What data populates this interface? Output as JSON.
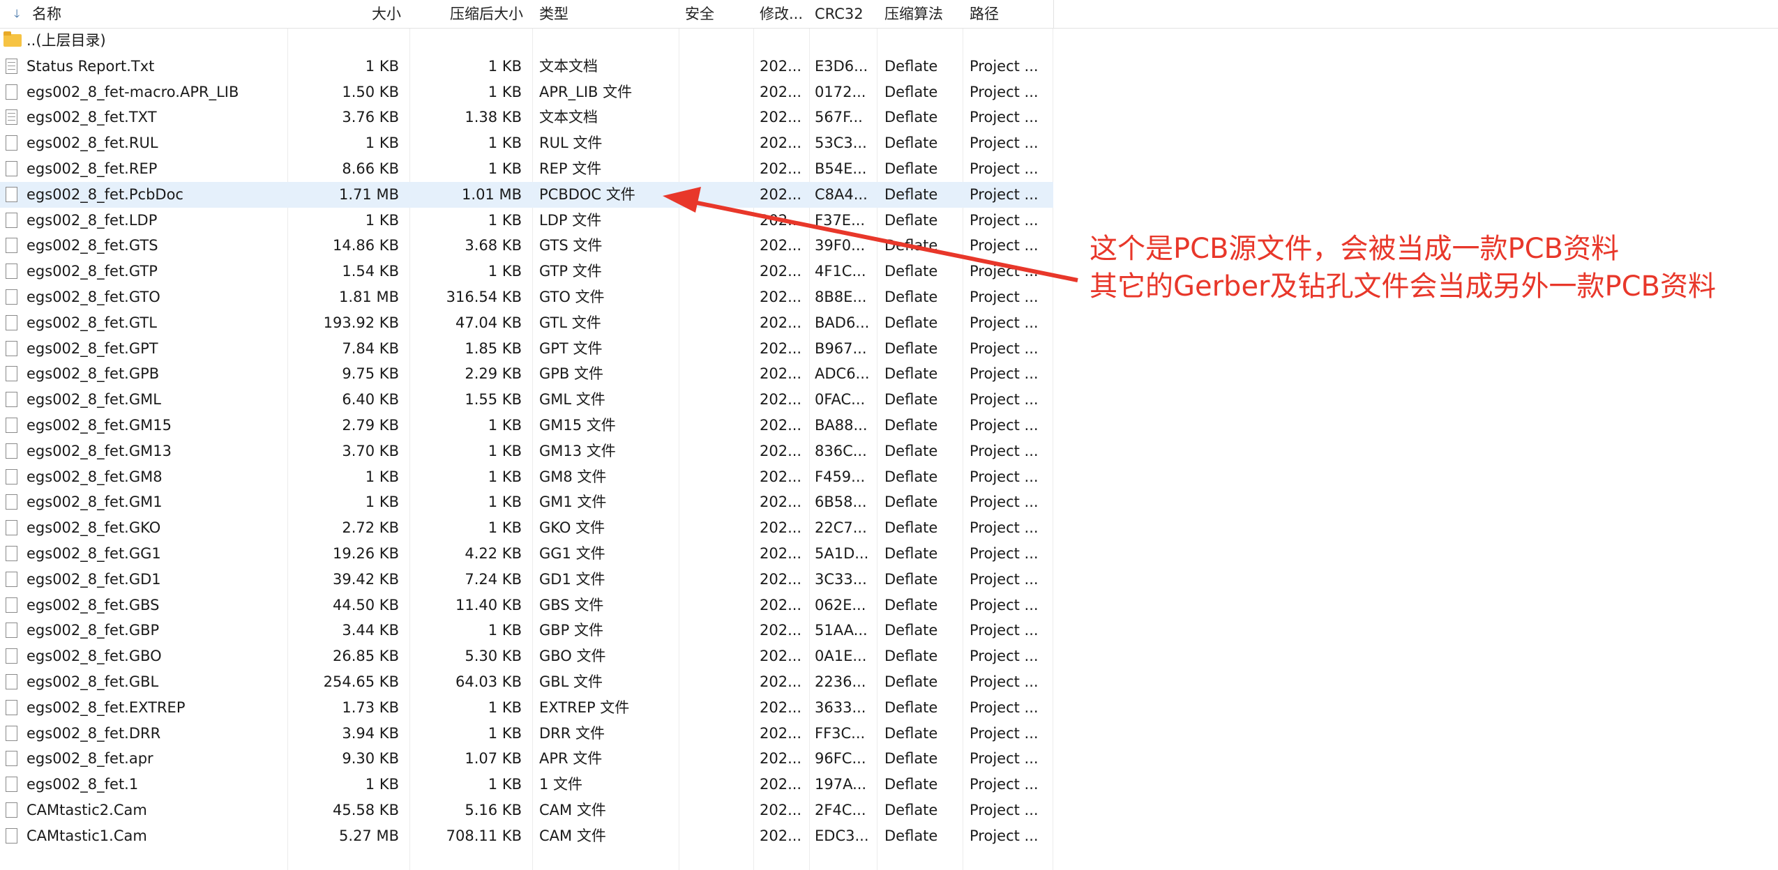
{
  "columns": {
    "name": "名称",
    "size": "大小",
    "compressed": "压缩后大小",
    "type": "类型",
    "security": "安全",
    "modified": "修改...",
    "crc": "CRC32",
    "algorithm": "压缩算法",
    "path": "路径"
  },
  "parent_row": {
    "name": "..(上层目录)"
  },
  "files": [
    {
      "name": "Status Report.Txt",
      "size": "1 KB",
      "compressed": "1 KB",
      "type": "文本文档",
      "modified": "202...",
      "crc": "E3D6...",
      "algorithm": "Deflate",
      "path": "Project ...",
      "icon": "text-file-icon"
    },
    {
      "name": "egs002_8_fet-macro.APR_LIB",
      "size": "1.50 KB",
      "compressed": "1 KB",
      "type": "APR_LIB 文件",
      "modified": "202...",
      "crc": "0172...",
      "algorithm": "Deflate",
      "path": "Project ...",
      "icon": "file-icon"
    },
    {
      "name": "egs002_8_fet.TXT",
      "size": "3.76 KB",
      "compressed": "1.38 KB",
      "type": "文本文档",
      "modified": "202...",
      "crc": "567F...",
      "algorithm": "Deflate",
      "path": "Project ...",
      "icon": "text-file-icon"
    },
    {
      "name": "egs002_8_fet.RUL",
      "size": "1 KB",
      "compressed": "1 KB",
      "type": "RUL 文件",
      "modified": "202...",
      "crc": "53C3...",
      "algorithm": "Deflate",
      "path": "Project ...",
      "icon": "file-icon"
    },
    {
      "name": "egs002_8_fet.REP",
      "size": "8.66 KB",
      "compressed": "1 KB",
      "type": "REP 文件",
      "modified": "202...",
      "crc": "B54E...",
      "algorithm": "Deflate",
      "path": "Project ...",
      "icon": "file-icon"
    },
    {
      "name": "egs002_8_fet.PcbDoc",
      "size": "1.71 MB",
      "compressed": "1.01 MB",
      "type": "PCBDOC 文件",
      "modified": "202...",
      "crc": "C8A4...",
      "algorithm": "Deflate",
      "path": "Project ...",
      "icon": "file-icon",
      "selected": true
    },
    {
      "name": "egs002_8_fet.LDP",
      "size": "1 KB",
      "compressed": "1 KB",
      "type": "LDP 文件",
      "modified": "202...",
      "crc": "F37E...",
      "algorithm": "Deflate",
      "path": "Project ...",
      "icon": "file-icon"
    },
    {
      "name": "egs002_8_fet.GTS",
      "size": "14.86 KB",
      "compressed": "3.68 KB",
      "type": "GTS 文件",
      "modified": "202...",
      "crc": "39F0...",
      "algorithm": "Deflate",
      "path": "Project ...",
      "icon": "file-icon"
    },
    {
      "name": "egs002_8_fet.GTP",
      "size": "1.54 KB",
      "compressed": "1 KB",
      "type": "GTP 文件",
      "modified": "202...",
      "crc": "4F1C...",
      "algorithm": "Deflate",
      "path": "Project ...",
      "icon": "file-icon"
    },
    {
      "name": "egs002_8_fet.GTO",
      "size": "1.81 MB",
      "compressed": "316.54 KB",
      "type": "GTO 文件",
      "modified": "202...",
      "crc": "8B8E...",
      "algorithm": "Deflate",
      "path": "Project ...",
      "icon": "file-icon"
    },
    {
      "name": "egs002_8_fet.GTL",
      "size": "193.92 KB",
      "compressed": "47.04 KB",
      "type": "GTL 文件",
      "modified": "202...",
      "crc": "BAD6...",
      "algorithm": "Deflate",
      "path": "Project ...",
      "icon": "file-icon"
    },
    {
      "name": "egs002_8_fet.GPT",
      "size": "7.84 KB",
      "compressed": "1.85 KB",
      "type": "GPT 文件",
      "modified": "202...",
      "crc": "B967...",
      "algorithm": "Deflate",
      "path": "Project ...",
      "icon": "file-icon"
    },
    {
      "name": "egs002_8_fet.GPB",
      "size": "9.75 KB",
      "compressed": "2.29 KB",
      "type": "GPB 文件",
      "modified": "202...",
      "crc": "ADC6...",
      "algorithm": "Deflate",
      "path": "Project ...",
      "icon": "file-icon"
    },
    {
      "name": "egs002_8_fet.GML",
      "size": "6.40 KB",
      "compressed": "1.55 KB",
      "type": "GML 文件",
      "modified": "202...",
      "crc": "0FAC...",
      "algorithm": "Deflate",
      "path": "Project ...",
      "icon": "file-icon"
    },
    {
      "name": "egs002_8_fet.GM15",
      "size": "2.79 KB",
      "compressed": "1 KB",
      "type": "GM15 文件",
      "modified": "202...",
      "crc": "BA88...",
      "algorithm": "Deflate",
      "path": "Project ...",
      "icon": "file-icon"
    },
    {
      "name": "egs002_8_fet.GM13",
      "size": "3.70 KB",
      "compressed": "1 KB",
      "type": "GM13 文件",
      "modified": "202...",
      "crc": "836C...",
      "algorithm": "Deflate",
      "path": "Project ...",
      "icon": "file-icon"
    },
    {
      "name": "egs002_8_fet.GM8",
      "size": "1 KB",
      "compressed": "1 KB",
      "type": "GM8 文件",
      "modified": "202...",
      "crc": "F459...",
      "algorithm": "Deflate",
      "path": "Project ...",
      "icon": "file-icon"
    },
    {
      "name": "egs002_8_fet.GM1",
      "size": "1 KB",
      "compressed": "1 KB",
      "type": "GM1 文件",
      "modified": "202...",
      "crc": "6B58...",
      "algorithm": "Deflate",
      "path": "Project ...",
      "icon": "file-icon"
    },
    {
      "name": "egs002_8_fet.GKO",
      "size": "2.72 KB",
      "compressed": "1 KB",
      "type": "GKO 文件",
      "modified": "202...",
      "crc": "22C7...",
      "algorithm": "Deflate",
      "path": "Project ...",
      "icon": "file-icon"
    },
    {
      "name": "egs002_8_fet.GG1",
      "size": "19.26 KB",
      "compressed": "4.22 KB",
      "type": "GG1 文件",
      "modified": "202...",
      "crc": "5A1D...",
      "algorithm": "Deflate",
      "path": "Project ...",
      "icon": "file-icon"
    },
    {
      "name": "egs002_8_fet.GD1",
      "size": "39.42 KB",
      "compressed": "7.24 KB",
      "type": "GD1 文件",
      "modified": "202...",
      "crc": "3C33...",
      "algorithm": "Deflate",
      "path": "Project ...",
      "icon": "file-icon"
    },
    {
      "name": "egs002_8_fet.GBS",
      "size": "44.50 KB",
      "compressed": "11.40 KB",
      "type": "GBS 文件",
      "modified": "202...",
      "crc": "062E...",
      "algorithm": "Deflate",
      "path": "Project ...",
      "icon": "file-icon"
    },
    {
      "name": "egs002_8_fet.GBP",
      "size": "3.44 KB",
      "compressed": "1 KB",
      "type": "GBP 文件",
      "modified": "202...",
      "crc": "51AA...",
      "algorithm": "Deflate",
      "path": "Project ...",
      "icon": "file-icon"
    },
    {
      "name": "egs002_8_fet.GBO",
      "size": "26.85 KB",
      "compressed": "5.30 KB",
      "type": "GBO 文件",
      "modified": "202...",
      "crc": "0A1E...",
      "algorithm": "Deflate",
      "path": "Project ...",
      "icon": "file-icon"
    },
    {
      "name": "egs002_8_fet.GBL",
      "size": "254.65 KB",
      "compressed": "64.03 KB",
      "type": "GBL 文件",
      "modified": "202...",
      "crc": "2236...",
      "algorithm": "Deflate",
      "path": "Project ...",
      "icon": "file-icon"
    },
    {
      "name": "egs002_8_fet.EXTREP",
      "size": "1.73 KB",
      "compressed": "1 KB",
      "type": "EXTREP 文件",
      "modified": "202...",
      "crc": "3633...",
      "algorithm": "Deflate",
      "path": "Project ...",
      "icon": "file-icon"
    },
    {
      "name": "egs002_8_fet.DRR",
      "size": "3.94 KB",
      "compressed": "1 KB",
      "type": "DRR 文件",
      "modified": "202...",
      "crc": "FF3C...",
      "algorithm": "Deflate",
      "path": "Project ...",
      "icon": "file-icon"
    },
    {
      "name": "egs002_8_fet.apr",
      "size": "9.30 KB",
      "compressed": "1.07 KB",
      "type": "APR 文件",
      "modified": "202...",
      "crc": "96FC...",
      "algorithm": "Deflate",
      "path": "Project ...",
      "icon": "file-icon"
    },
    {
      "name": "egs002_8_fet.1",
      "size": "1 KB",
      "compressed": "1 KB",
      "type": "1 文件",
      "modified": "202...",
      "crc": "197A...",
      "algorithm": "Deflate",
      "path": "Project ...",
      "icon": "file-icon"
    },
    {
      "name": "CAMtastic2.Cam",
      "size": "45.58 KB",
      "compressed": "5.16 KB",
      "type": "CAM 文件",
      "modified": "202...",
      "crc": "2F4C...",
      "algorithm": "Deflate",
      "path": "Project ...",
      "icon": "file-icon"
    },
    {
      "name": "CAMtastic1.Cam",
      "size": "5.27 MB",
      "compressed": "708.11 KB",
      "type": "CAM 文件",
      "modified": "202...",
      "crc": "EDC3...",
      "algorithm": "Deflate",
      "path": "Project ...",
      "icon": "file-icon"
    }
  ],
  "annotation": {
    "line1": "这个是PCB源文件，会被当成一款PCB资料",
    "line2": "其它的Gerber及钻孔文件会当成另外一款PCB资料",
    "color": "#e8372a"
  },
  "colors": {
    "selected_row": "#e5f0fb",
    "folder": "#f6c343"
  }
}
